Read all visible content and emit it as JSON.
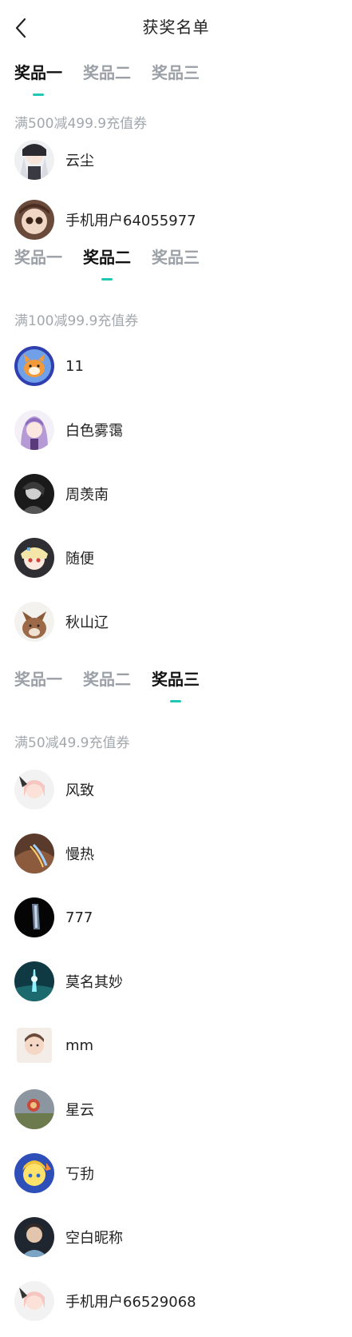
{
  "header": {
    "title": "获奖名单",
    "back_icon": "chevron-left-icon"
  },
  "tab_labels": [
    "奖品一",
    "奖品二",
    "奖品三"
  ],
  "sections": [
    {
      "active_tab": 0,
      "description": "满500减499.9充值券",
      "winners": [
        {
          "name": "云尘",
          "avatar": "anime-girl-avatar"
        },
        {
          "name": "手机用户64055977",
          "avatar": "anime-girl-avatar"
        }
      ]
    },
    {
      "active_tab": 1,
      "description": "满100减99.9充值券",
      "winners": [
        {
          "name": "11",
          "avatar": "dog-avatar"
        },
        {
          "name": "白色雾霭",
          "avatar": "anime-girl-avatar"
        },
        {
          "name": "周羡南",
          "avatar": "person-avatar"
        },
        {
          "name": "随便",
          "avatar": "anime-girl-avatar"
        },
        {
          "name": "秋山辽",
          "avatar": "fox-avatar"
        }
      ]
    },
    {
      "active_tab": 2,
      "description": "满50减49.9充值券",
      "winners": [
        {
          "name": "风致",
          "avatar": "anime-girl-avatar"
        },
        {
          "name": "慢热",
          "avatar": "landscape-avatar"
        },
        {
          "name": "777",
          "avatar": "dark-avatar"
        },
        {
          "name": "莫名其妙",
          "avatar": "scene-avatar"
        },
        {
          "name": "mm",
          "avatar": "child-photo-avatar"
        },
        {
          "name": "星云",
          "avatar": "landscape-avatar"
        },
        {
          "name": "丂劧",
          "avatar": "anime-character-avatar"
        },
        {
          "name": "空白昵称",
          "avatar": "person-avatar"
        },
        {
          "name": "手机用户66529068",
          "avatar": "anime-girl-avatar"
        }
      ]
    }
  ],
  "colors": {
    "accent": "#1ec8b4",
    "muted": "#9aa0a6"
  }
}
